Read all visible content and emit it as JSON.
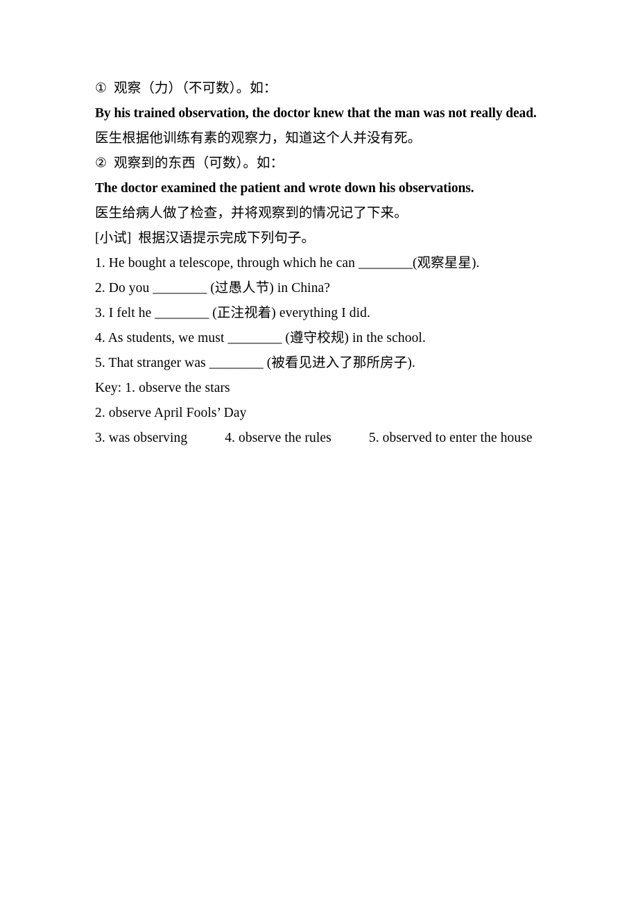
{
  "document": {
    "background_color": "#ffffff",
    "text_color": "#000000",
    "blank": "________"
  },
  "definitions": [
    {
      "marker": "①",
      "gloss": "观察（力）（不可数）。如：",
      "example_en": "By his trained observation, the doctor knew that the man was not really dead.",
      "example_cn": "医生根据他训练有素的观察力，知道这个人并没有死。"
    },
    {
      "marker": "②",
      "gloss": "观察到的东西（可数）。如：",
      "example_en": "The doctor examined the patient and wrote down his observations.",
      "example_cn": "医生给病人做了检查，并将观察到的情况记了下来。"
    }
  ],
  "drill": {
    "heading": "[小试]  根据汉语提示完成下列句子。",
    "items": [
      {
        "number": "1.",
        "before": " He bought a telescope, through which he can ",
        "blank": "________",
        "after": "(观察星星)."
      },
      {
        "number": "2.",
        "before": " Do you ",
        "blank": "________",
        "after": " (过愚人节) in China?"
      },
      {
        "number": "3.",
        "before": " I felt he ",
        "blank": "________",
        "after": " (正注视着) everything I did."
      },
      {
        "number": "4.",
        "before": " As students, we must ",
        "blank": "________",
        "after": " (遵守校规) in the school."
      },
      {
        "number": "5.",
        "before": " That stranger was ",
        "blank": "________",
        "after": " (被看见进入了那所房子)."
      }
    ]
  },
  "key": {
    "label": "Key:",
    "line1": " 1. observe the stars",
    "line2": "2. observe April Fools’ Day",
    "line3_a": "3. was observing",
    "line3_b": "4. observe the rules",
    "line3_c": "5. observed to enter the house"
  }
}
